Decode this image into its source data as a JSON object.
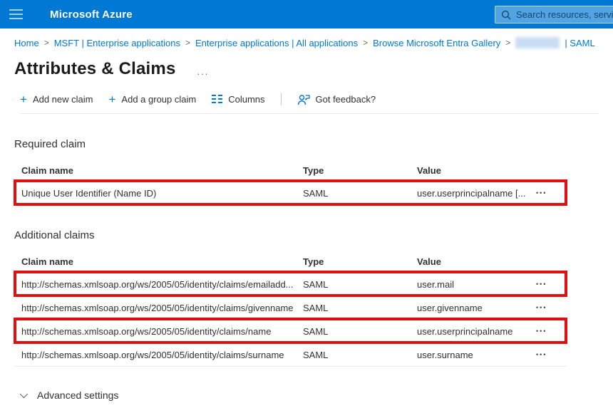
{
  "colors": {
    "header_bg": "#0078d4",
    "accent": "#0078d4",
    "link": "#0078d4",
    "text": "#323130",
    "divider": "#eaeaea",
    "highlight": "#e01010"
  },
  "header": {
    "app_title": "Microsoft Azure",
    "search_placeholder": "Search resources, service"
  },
  "breadcrumb": {
    "links": [
      "Home",
      "MSFT | Enterprise applications",
      "Enterprise applications | All applications",
      "Browse Microsoft Entra Gallery"
    ],
    "separator": ">",
    "current_suffix": "| SAML"
  },
  "page": {
    "title": "Attributes & Claims",
    "more_label": "..."
  },
  "toolbar": {
    "add_new_claim": "Add new claim",
    "add_group_claim": "Add a group claim",
    "columns": "Columns",
    "feedback": "Got feedback?",
    "plus": "+"
  },
  "ui": {
    "menu_dots": "•••"
  },
  "required_claim": {
    "section_title": "Required claim",
    "columns": [
      "Claim name",
      "Type",
      "Value"
    ],
    "rows": [
      {
        "claim_name": "Unique User Identifier (Name ID)",
        "type": "SAML",
        "value": "user.userprincipalname [...",
        "highlighted": true
      }
    ]
  },
  "additional_claims": {
    "section_title": "Additional claims",
    "columns": [
      "Claim name",
      "Type",
      "Value"
    ],
    "rows": [
      {
        "claim_name": "http://schemas.xmlsoap.org/ws/2005/05/identity/claims/emailadd...",
        "type": "SAML",
        "value": "user.mail",
        "highlighted": true
      },
      {
        "claim_name": "http://schemas.xmlsoap.org/ws/2005/05/identity/claims/givenname",
        "type": "SAML",
        "value": "user.givenname",
        "highlighted": false
      },
      {
        "claim_name": "http://schemas.xmlsoap.org/ws/2005/05/identity/claims/name",
        "type": "SAML",
        "value": "user.userprincipalname",
        "highlighted": true
      },
      {
        "claim_name": "http://schemas.xmlsoap.org/ws/2005/05/identity/claims/surname",
        "type": "SAML",
        "value": "user.surname",
        "highlighted": false
      }
    ]
  },
  "advanced_settings": {
    "label": "Advanced settings"
  }
}
